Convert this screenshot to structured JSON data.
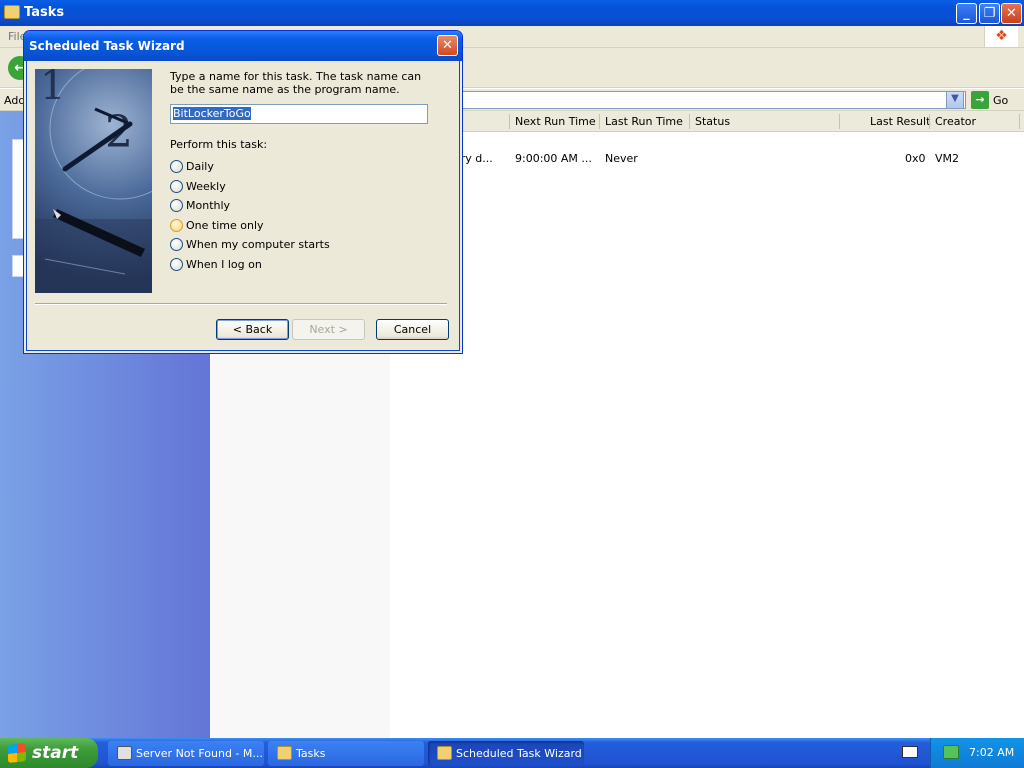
{
  "explorer": {
    "title": "Tasks",
    "menu_file": "File",
    "address_label": "Address",
    "go_label": "Go",
    "columns": [
      "Next Run Time",
      "Last Run Time",
      "Status",
      "Last Result",
      "Creator"
    ],
    "row": {
      "schedule": "ery d...",
      "next_run": "9:00:00 AM  ...",
      "last_run": "Never",
      "status": "",
      "last_result": "0x0",
      "creator": "VM2"
    }
  },
  "dialog": {
    "title": "Scheduled Task Wizard",
    "prompt": "Type a name for this task.  The task name can be the same name as the program name.",
    "task_name": "BitLockerToGo",
    "perform_label": "Perform this task:",
    "options": [
      "Daily",
      "Weekly",
      "Monthly",
      "One time only",
      "When my computer starts",
      "When I log on"
    ],
    "back_label": "< Back",
    "next_label": "Next >",
    "cancel_label": "Cancel"
  },
  "taskbar": {
    "start_label": "start",
    "items": [
      "Server Not Found - M...",
      "Tasks",
      "Scheduled Task Wizard"
    ],
    "time": "7:02 AM"
  }
}
